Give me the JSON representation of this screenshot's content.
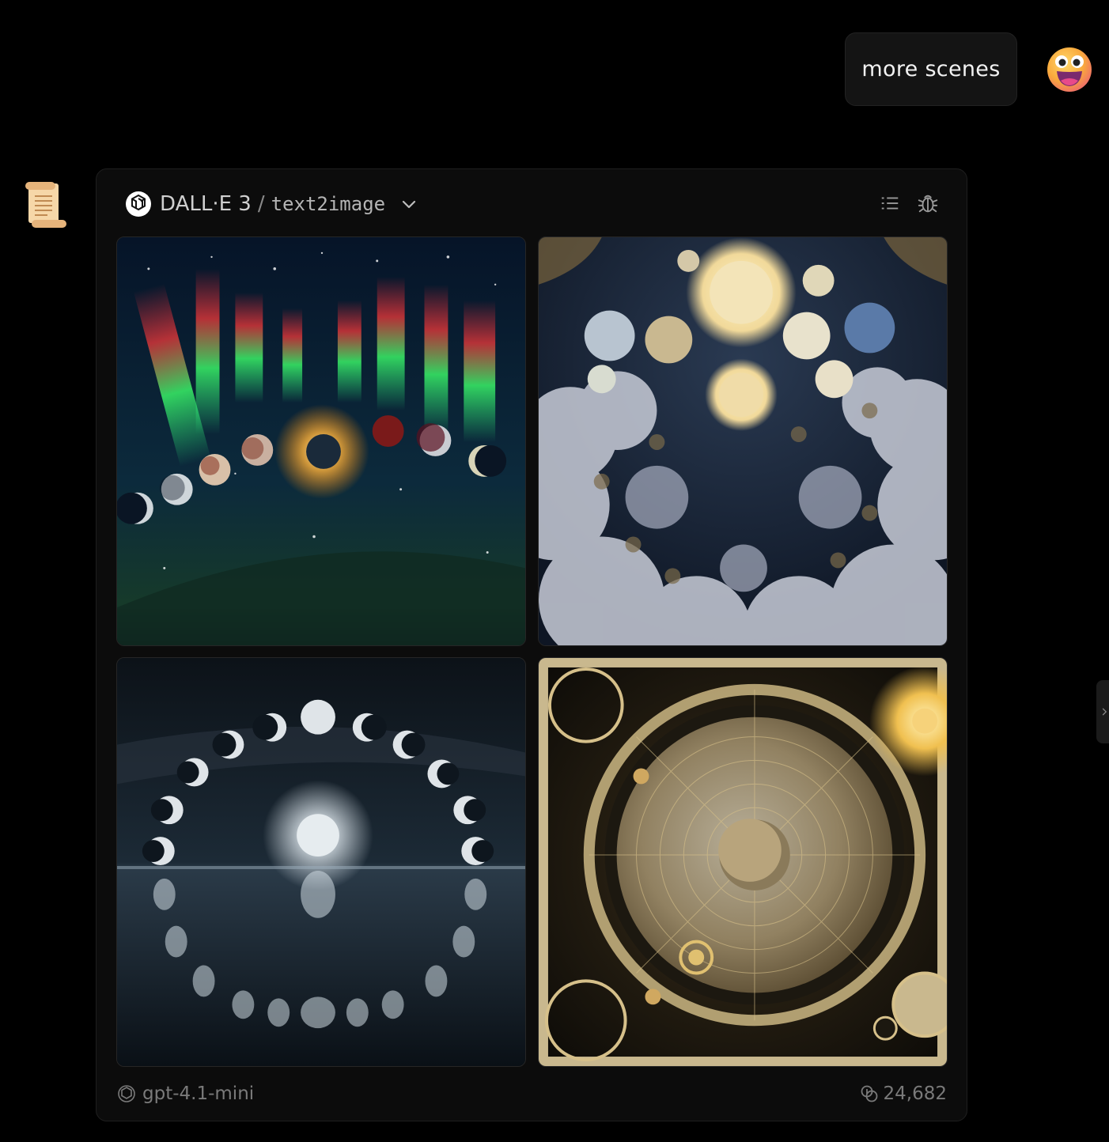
{
  "user_message": {
    "text": "more scenes"
  },
  "assistant": {
    "model": "DALL·E 3",
    "separator": "/",
    "endpoint": "text2image",
    "footer_model": "gpt-4.1-mini",
    "token_count": "24,682"
  },
  "icons": {
    "user_avatar": "grinning-face-icon",
    "assistant_avatar": "scroll-icon",
    "provider": "openai-logo-icon",
    "dropdown": "chevron-down-icon",
    "list": "list-icon",
    "debug": "bug-icon",
    "footer_model": "openai-logo-icon",
    "tokens": "token-coins-icon",
    "side_handle": "chevron-right-icon"
  },
  "colors": {
    "background": "#000000",
    "card": "#0c0c0c",
    "bubble": "#141414"
  }
}
